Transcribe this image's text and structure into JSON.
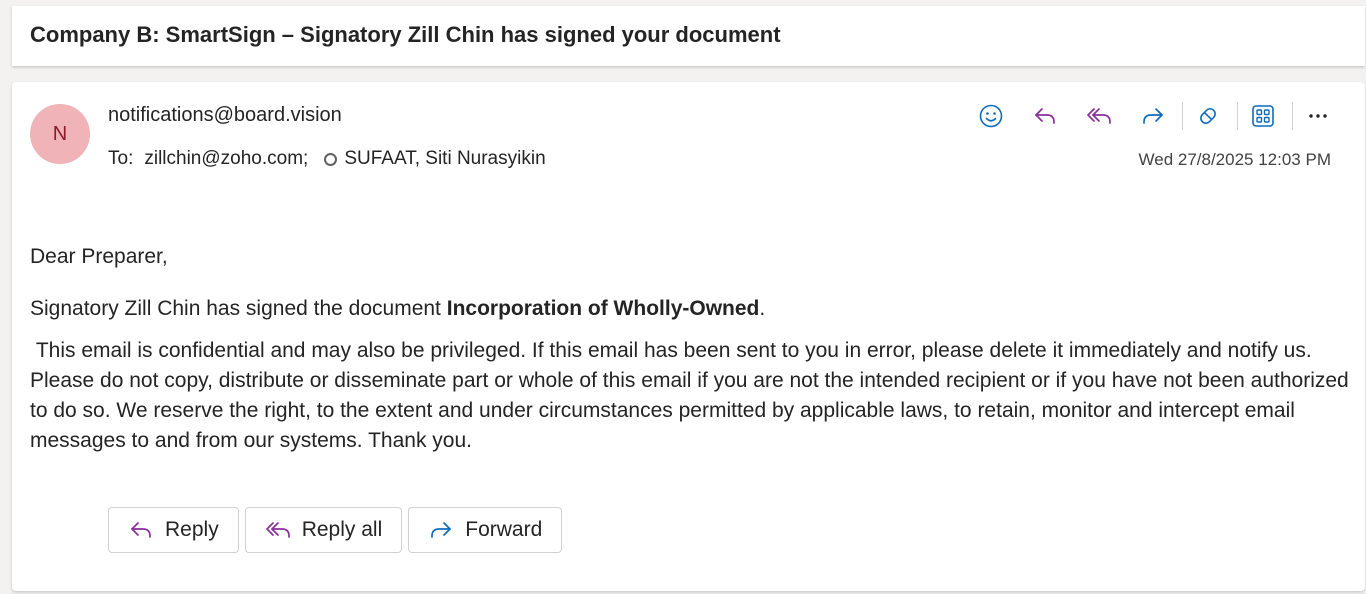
{
  "subject": "Company B: SmartSign – Signatory Zill Chin has signed your document",
  "sender": {
    "initial": "N",
    "address": "notifications@board.vision",
    "avatar_color": "#f0b3b8"
  },
  "recipients": {
    "label": "To:",
    "list": [
      "zillchin@zoho.com;",
      "SUFAAT, Siti Nurasyikin"
    ]
  },
  "date": "Wed 27/8/2025 12:03 PM",
  "toolbar": {
    "icons": [
      "smiley-icon",
      "reply-icon",
      "reply-all-icon",
      "forward-icon",
      "tag-icon",
      "apps-icon",
      "more-icon"
    ]
  },
  "body": {
    "greeting": "Dear Preparer,",
    "line_prefix": "Signatory Zill Chin has signed the document ",
    "document_name": "Incorporation of Wholly-Owned",
    "line_suffix": ".",
    "disclaimer": " This email is confidential and may also be privileged. If this email has been sent to you in error, please delete it immediately and notify us. Please do not copy, distribute or disseminate part or whole of this email if you are not the intended recipient or if you have not been authorized to do so. We reserve the right, to the extent and under circumstances permitted by applicable laws, to retain, monitor and intercept email messages to and from our systems. Thank you."
  },
  "actions": {
    "reply": "Reply",
    "reply_all": "Reply all",
    "forward": "Forward"
  },
  "colors": {
    "reply_purple": "#8a2f9c",
    "forward_blue": "#0f6cbd",
    "icon_blue": "#0f6cbd"
  }
}
